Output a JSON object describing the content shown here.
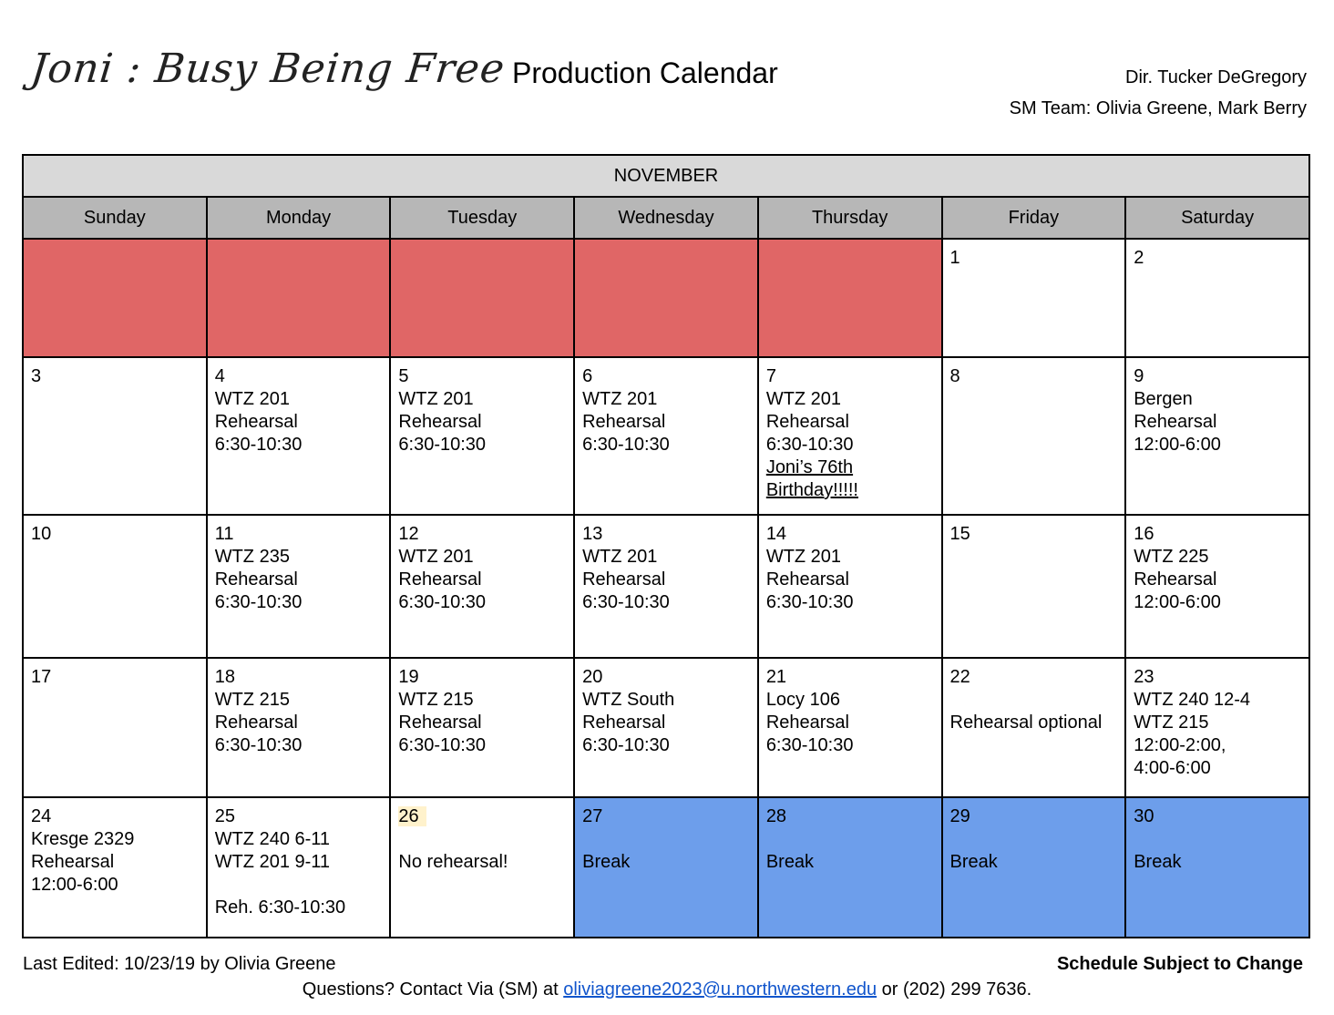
{
  "header": {
    "logo_text": "Joni : Busy Being Free",
    "title": "Production Calendar",
    "director": "Dir. Tucker DeGregory",
    "sm_team": "SM Team: Olivia Greene, Mark Berry"
  },
  "calendar": {
    "month": "NOVEMBER",
    "days": [
      "Sunday",
      "Monday",
      "Tuesday",
      "Wednesday",
      "Thursday",
      "Friday",
      "Saturday"
    ],
    "weeks": [
      [
        {
          "date": "",
          "lines": [],
          "style": "red"
        },
        {
          "date": "",
          "lines": [],
          "style": "red"
        },
        {
          "date": "",
          "lines": [],
          "style": "red"
        },
        {
          "date": "",
          "lines": [],
          "style": "red"
        },
        {
          "date": "",
          "lines": [],
          "style": "red"
        },
        {
          "date": "1",
          "lines": [],
          "style": ""
        },
        {
          "date": "2",
          "lines": [],
          "style": ""
        }
      ],
      [
        {
          "date": "3",
          "lines": [],
          "style": ""
        },
        {
          "date": "4",
          "lines": [
            "WTZ 201",
            "Rehearsal",
            "6:30-10:30"
          ],
          "style": ""
        },
        {
          "date": "5",
          "lines": [
            "WTZ 201",
            "Rehearsal",
            "6:30-10:30"
          ],
          "style": ""
        },
        {
          "date": "6",
          "lines": [
            "WTZ 201",
            "Rehearsal",
            "6:30-10:30"
          ],
          "style": ""
        },
        {
          "date": "7",
          "lines": [
            "WTZ 201",
            "Rehearsal",
            "6:30-10:30"
          ],
          "underlined": [
            "Joni’s 76th",
            "Birthday!!!!!"
          ],
          "style": ""
        },
        {
          "date": "8",
          "lines": [],
          "style": ""
        },
        {
          "date": "9",
          "lines": [
            "Bergen",
            "Rehearsal",
            "12:00-6:00"
          ],
          "style": ""
        }
      ],
      [
        {
          "date": "10",
          "lines": [],
          "style": ""
        },
        {
          "date": "11",
          "lines": [
            "WTZ 235",
            "Rehearsal",
            "6:30-10:30"
          ],
          "style": ""
        },
        {
          "date": "12",
          "lines": [
            "WTZ 201",
            "Rehearsal",
            "6:30-10:30"
          ],
          "style": ""
        },
        {
          "date": "13",
          "lines": [
            "WTZ 201",
            "Rehearsal",
            "6:30-10:30"
          ],
          "style": ""
        },
        {
          "date": "14",
          "lines": [
            "WTZ 201",
            "Rehearsal",
            "6:30-10:30"
          ],
          "style": ""
        },
        {
          "date": "15",
          "lines": [],
          "style": ""
        },
        {
          "date": "16",
          "lines": [
            "WTZ 225",
            "Rehearsal",
            "12:00-6:00"
          ],
          "style": ""
        }
      ],
      [
        {
          "date": "17",
          "lines": [],
          "style": ""
        },
        {
          "date": "18",
          "lines": [
            "WTZ 215",
            "Rehearsal",
            "6:30-10:30"
          ],
          "style": ""
        },
        {
          "date": "19",
          "lines": [
            "WTZ 215",
            "Rehearsal",
            "6:30-10:30"
          ],
          "style": ""
        },
        {
          "date": "20",
          "lines": [
            "WTZ South",
            "Rehearsal",
            "6:30-10:30"
          ],
          "style": ""
        },
        {
          "date": "21",
          "lines": [
            "Locy 106",
            "Rehearsal",
            "6:30-10:30"
          ],
          "style": ""
        },
        {
          "date": "22",
          "lines": [
            "",
            "Rehearsal optional"
          ],
          "style": ""
        },
        {
          "date": "23",
          "lines": [
            "WTZ 240 12-4",
            "WTZ 215",
            "12:00-2:00,",
            "4:00-6:00"
          ],
          "style": ""
        }
      ],
      [
        {
          "date": "24",
          "lines": [
            "Kresge 2329",
            "Rehearsal",
            "12:00-6:00"
          ],
          "style": ""
        },
        {
          "date": "25",
          "lines": [
            "WTZ 240 6-11",
            "WTZ 201 9-11",
            "",
            "Reh. 6:30-10:30"
          ],
          "style": ""
        },
        {
          "date": "26",
          "lines": [
            "",
            "No rehearsal!"
          ],
          "style": "",
          "date_highlight": true
        },
        {
          "date": "27",
          "lines": [
            "",
            "Break"
          ],
          "style": "blue"
        },
        {
          "date": "28",
          "lines": [
            "",
            "Break"
          ],
          "style": "blue"
        },
        {
          "date": "29",
          "lines": [
            "",
            "Break"
          ],
          "style": "blue"
        },
        {
          "date": "30",
          "lines": [
            "",
            "Break"
          ],
          "style": "blue"
        }
      ]
    ]
  },
  "footer": {
    "last_edited": "Last Edited: 10/23/19 by Olivia Greene",
    "subject_to_change": "Schedule Subject to Change",
    "contact_prefix": "Questions? Contact Via (SM) at ",
    "email": "oliviagreene2023@u.northwestern.edu",
    "contact_suffix": " or (202) 299 7636."
  },
  "colors": {
    "unused_days": "#e06666",
    "break_days": "#6d9eeb",
    "month_header": "#d9d9d9",
    "day_header": "#b7b7b7",
    "link": "#1155cc"
  }
}
